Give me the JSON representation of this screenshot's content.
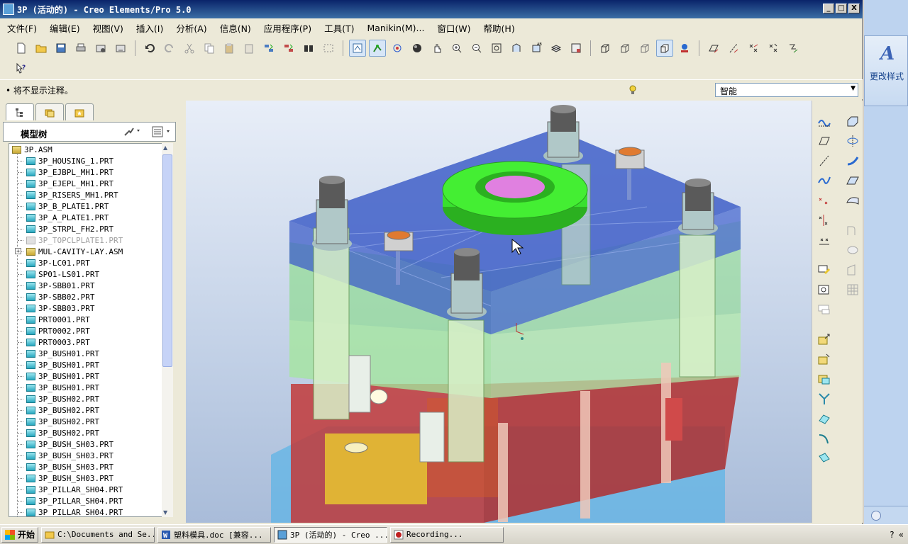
{
  "window": {
    "title": "3P (活动的) - Creo Elements/Pro 5.0",
    "buttons": {
      "minimize": "_",
      "maximize": "□",
      "close": "X"
    }
  },
  "menu": [
    "文件(F)",
    "编辑(E)",
    "视图(V)",
    "插入(I)",
    "分析(A)",
    "信息(N)",
    "应用程序(P)",
    "工具(T)",
    "Manikin(M)...",
    "窗口(W)",
    "帮助(H)"
  ],
  "message": {
    "text": "• 将不显示注释。"
  },
  "filter": {
    "value": "智能"
  },
  "model_tree": {
    "header": "模型树",
    "root": "3P.ASM",
    "items": [
      {
        "label": "3P_HOUSING_1.PRT",
        "kind": "prt"
      },
      {
        "label": "3P_EJBPL_MH1.PRT",
        "kind": "prt"
      },
      {
        "label": "3P_EJEPL_MH1.PRT",
        "kind": "prt"
      },
      {
        "label": "3P_RISERS_MH1.PRT",
        "kind": "prt"
      },
      {
        "label": "3P_B_PLATE1.PRT",
        "kind": "prt"
      },
      {
        "label": "3P_A_PLATE1.PRT",
        "kind": "prt"
      },
      {
        "label": "3P_STRPL_FH2.PRT",
        "kind": "prt"
      },
      {
        "label": "3P_TOPCLPLATE1.PRT",
        "kind": "dim"
      },
      {
        "label": "MUL-CAVITY-LAY.ASM",
        "kind": "asm"
      },
      {
        "label": "3P-LC01.PRT",
        "kind": "prt"
      },
      {
        "label": "SP01-LS01.PRT",
        "kind": "prt"
      },
      {
        "label": "3P-SBB01.PRT",
        "kind": "prt"
      },
      {
        "label": "3P-SBB02.PRT",
        "kind": "prt"
      },
      {
        "label": "3P-SBB03.PRT",
        "kind": "prt"
      },
      {
        "label": "PRT0001.PRT",
        "kind": "prt"
      },
      {
        "label": "PRT0002.PRT",
        "kind": "prt"
      },
      {
        "label": "PRT0003.PRT",
        "kind": "prt"
      },
      {
        "label": "3P_BUSH01.PRT",
        "kind": "prt"
      },
      {
        "label": "3P_BUSH01.PRT",
        "kind": "prt"
      },
      {
        "label": "3P_BUSH01.PRT",
        "kind": "prt"
      },
      {
        "label": "3P_BUSH01.PRT",
        "kind": "prt"
      },
      {
        "label": "3P_BUSH02.PRT",
        "kind": "prt"
      },
      {
        "label": "3P_BUSH02.PRT",
        "kind": "prt"
      },
      {
        "label": "3P_BUSH02.PRT",
        "kind": "prt"
      },
      {
        "label": "3P_BUSH02.PRT",
        "kind": "prt"
      },
      {
        "label": "3P_BUSH_SH03.PRT",
        "kind": "prt"
      },
      {
        "label": "3P_BUSH_SH03.PRT",
        "kind": "prt"
      },
      {
        "label": "3P_BUSH_SH03.PRT",
        "kind": "prt"
      },
      {
        "label": "3P_BUSH_SH03.PRT",
        "kind": "prt"
      },
      {
        "label": "3P_PILLAR_SH04.PRT",
        "kind": "prt"
      },
      {
        "label": "3P_PILLAR_SH04.PRT",
        "kind": "prt"
      },
      {
        "label": "3P_PILLAR_SH04.PRT",
        "kind": "prt"
      }
    ]
  },
  "word_panel": {
    "label": "更改样式"
  },
  "taskbar": {
    "start": "开始",
    "tasks": [
      {
        "label": "C:\\Documents and Se...",
        "icon": "folder-icon"
      },
      {
        "label": "塑料模具.doc [兼容...",
        "icon": "word-icon"
      },
      {
        "label": "3P (活动的) - Creo ...",
        "icon": "creo-icon",
        "active": true
      },
      {
        "label": "Recording...",
        "icon": "recording-icon"
      }
    ],
    "tray": {
      "help": "?",
      "more": "«"
    }
  },
  "colors": {
    "plate_blue": "#3f5fc8",
    "plate_green": "#7fdc7a",
    "plate_red": "#c23a3a",
    "ring_green": "#38e02e",
    "base_cyan": "#5fb4e6",
    "yellow_block": "#e8c630"
  }
}
